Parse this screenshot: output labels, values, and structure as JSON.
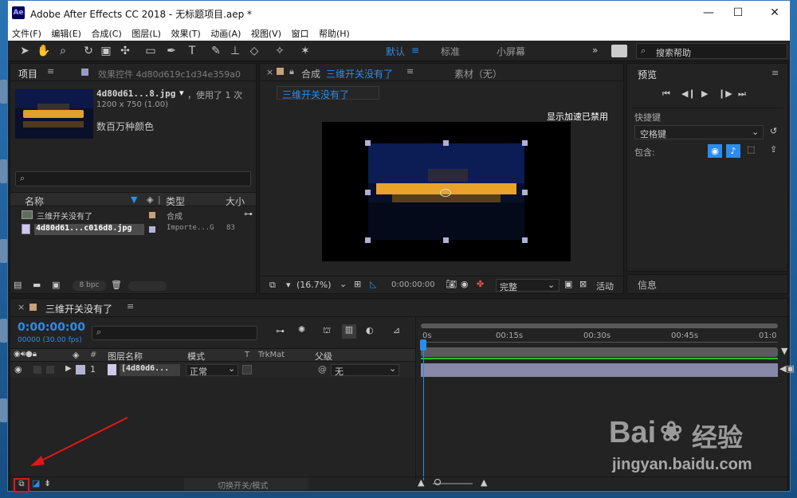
{
  "window": {
    "title": "Adobe After Effects CC 2018 - 无标题项目.aep *",
    "logo": "Ae",
    "minimize": "—",
    "maximize": "☐",
    "close": "✕"
  },
  "menu": [
    "文件(F)",
    "编辑(E)",
    "合成(C)",
    "图层(L)",
    "效果(T)",
    "动画(A)",
    "视图(V)",
    "窗口",
    "帮助(H)"
  ],
  "toolbar": {
    "workspaces": [
      "默认",
      "标准",
      "小屏幕"
    ],
    "search_placeholder": "搜索帮助"
  },
  "project_panel": {
    "tab_project": "项目",
    "tab_effects": "效果控件 4d80d619c1d34e359a0",
    "file_name": "4d80d61...8.jpg",
    "usage": "，使用了 1 次",
    "dimensions": "1200 x 750 (1.00)",
    "color_info": "数百万种颜色",
    "columns": {
      "name": "名称",
      "type": "类型",
      "size": "大小"
    },
    "items": [
      {
        "name": "三维开关没有了",
        "type": "合成",
        "size": ""
      },
      {
        "name": "4d80d61...c016d8.jpg",
        "type": "Importe...G",
        "size": "83"
      }
    ],
    "bpc": "8 bpc"
  },
  "composition_panel": {
    "tab_label": "合成",
    "comp_name": "三维开关没有了",
    "footage_tab": "素材（无）",
    "breadcrumb": "三维开关没有了",
    "gpu_notice": "显示加速已禁用",
    "zoom": "(16.7%)",
    "timecode": "0:00:00:00",
    "resolution": "完整",
    "active_camera": "活动"
  },
  "preview_panel": {
    "title": "预览",
    "shortcut_label": "快捷键",
    "shortcut_value": "空格键",
    "include_label": "包含:",
    "info_label": "信息"
  },
  "timeline": {
    "comp_name": "三维开关没有了",
    "timecode": "0:00:00:00",
    "fps": "00000 (30.00 fps)",
    "columns": {
      "num": "#",
      "layer_name": "图层名称",
      "mode": "模式",
      "t": "T",
      "trkmat": "TrkMat",
      "parent": "父级"
    },
    "layers": [
      {
        "index": "1",
        "name": "[4d80d6...",
        "mode": "正常",
        "parent": "无"
      }
    ],
    "ruler": [
      "0s",
      "00:15s",
      "00:30s",
      "00:45s",
      "01:0"
    ],
    "toggle_label": "切换开关/模式"
  },
  "watermark": {
    "brand": "Bai",
    "brand2": "经验",
    "url": "jingyan.baidu.com"
  }
}
